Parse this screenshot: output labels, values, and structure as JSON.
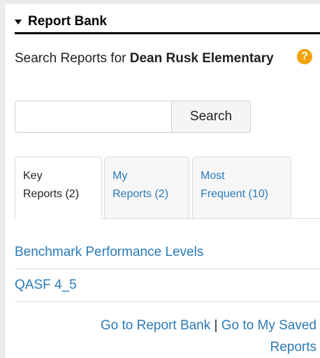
{
  "header": {
    "title": "Report Bank"
  },
  "search": {
    "label_prefix": "Search Reports for",
    "school": "Dean Rusk Elementary",
    "input_value": "",
    "placeholder": "",
    "button_label": "Search"
  },
  "help": {
    "icon": "question-circle-icon",
    "glyph": "?"
  },
  "tabs": [
    {
      "line1": "Key",
      "line2": "Reports (2)",
      "active": true
    },
    {
      "line1": "My",
      "line2": "Reports (2)",
      "active": false
    },
    {
      "line1": "Most",
      "line2": "Frequent (10)",
      "active": false
    }
  ],
  "reports": [
    {
      "label": "Benchmark Performance Levels"
    },
    {
      "label": "QASF 4_5"
    }
  ],
  "footer": {
    "link1": "Go to Report Bank",
    "separator": "|",
    "link2": "Go to My Saved Reports"
  },
  "colors": {
    "link": "#2a7ab8",
    "help_icon": "#f0a30a",
    "header_rule": "#000000"
  }
}
